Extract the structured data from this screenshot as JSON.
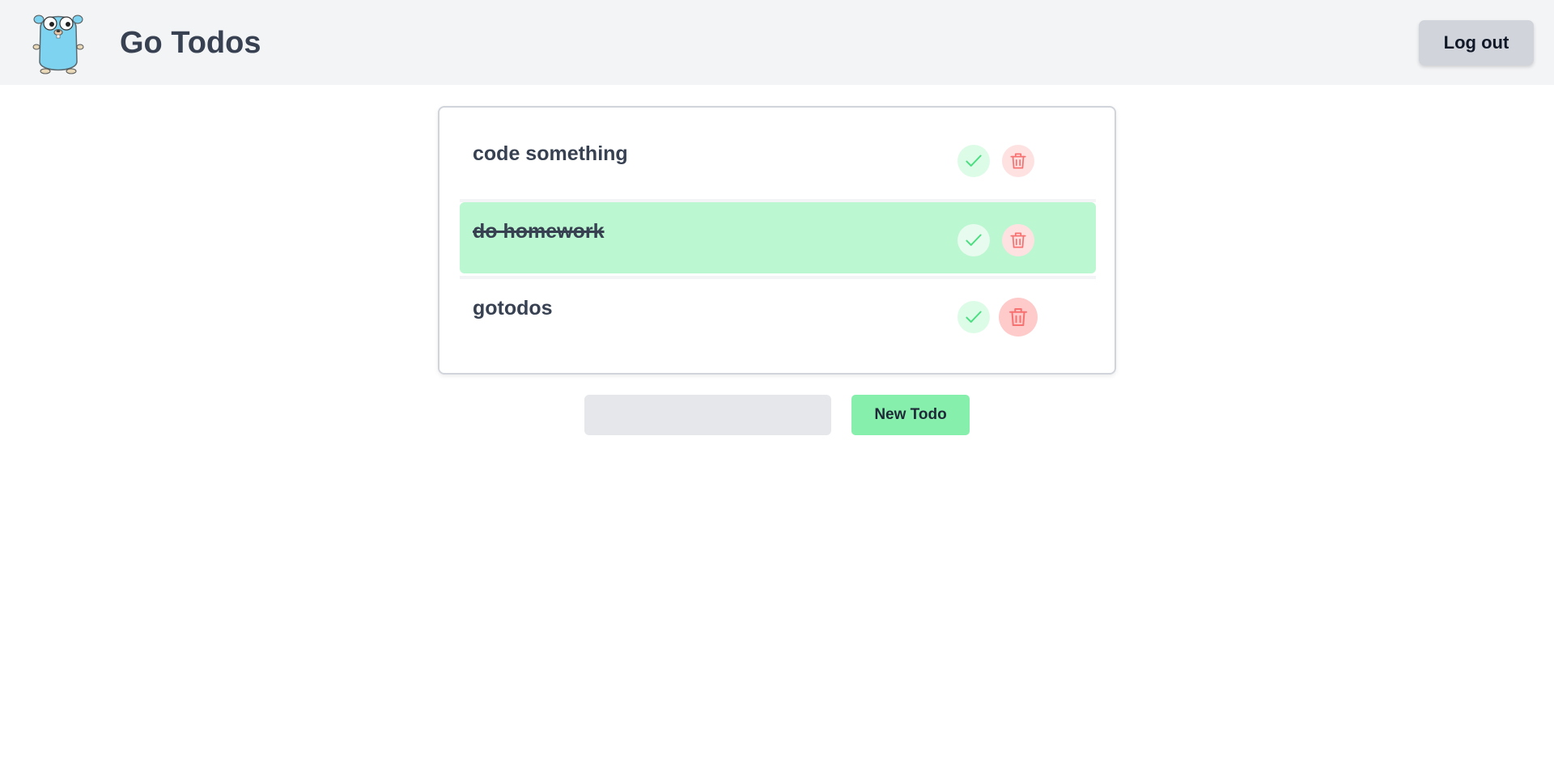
{
  "header": {
    "title": "Go Todos",
    "logout_label": "Log out",
    "logo_icon": "gopher-mascot-icon"
  },
  "todos": [
    {
      "text": "code something",
      "done": false
    },
    {
      "text": "do homework",
      "done": true
    },
    {
      "text": "gotodos",
      "done": false
    }
  ],
  "new_todo": {
    "value": "",
    "placeholder": "",
    "button_label": "New Todo"
  },
  "colors": {
    "navbar_bg": "#f3f4f6",
    "done_row": "#bbf7d0",
    "check_icon": "#4ade80",
    "trash_icon": "#f87171",
    "new_todo_button": "#86efac"
  }
}
